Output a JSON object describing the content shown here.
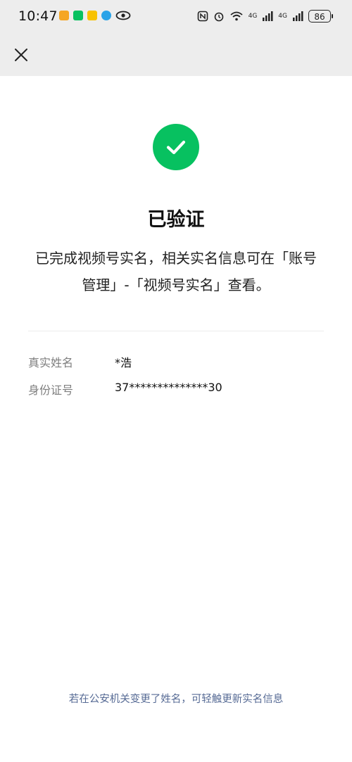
{
  "status_bar": {
    "time": "10:47",
    "battery": "86",
    "network_1": "4G",
    "network_2": "4G"
  },
  "nav": {
    "close_icon": "close-icon"
  },
  "result": {
    "icon": "check-circle-icon",
    "icon_color": "#07c160",
    "title": "已验证",
    "description": "已完成视频号实名，相关实名信息可在「账号管理」-「视频号实名」查看。"
  },
  "info": [
    {
      "label": "真实姓名",
      "value": "*浩"
    },
    {
      "label": "身份证号",
      "value": "37**************30"
    }
  ],
  "footer": {
    "link_text": "若在公安机关变更了姓名，可轻触更新实名信息",
    "link_color": "#576b95"
  }
}
